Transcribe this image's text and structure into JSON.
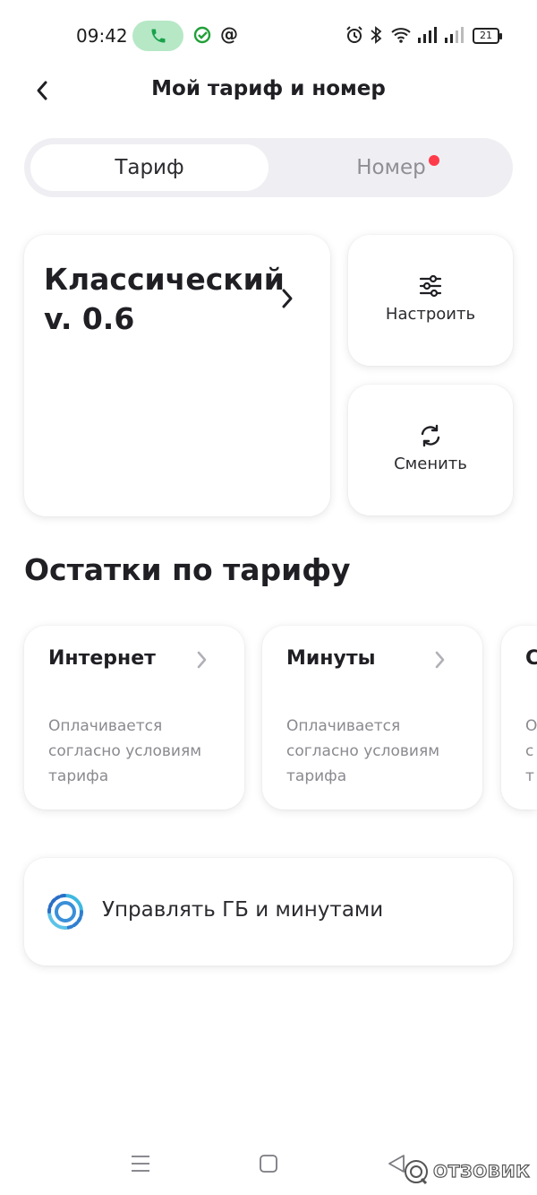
{
  "status_bar": {
    "time": "09:42",
    "battery": "21"
  },
  "header": {
    "title": "Мой тариф и номер"
  },
  "tabs": [
    {
      "label": "Тариф",
      "active": true
    },
    {
      "label": "Номер",
      "active": false,
      "has_badge": true
    }
  ],
  "tariff": {
    "name": "Классический v. 0.6"
  },
  "actions": [
    {
      "label": "Настроить",
      "icon": "sliders-icon"
    },
    {
      "label": "Сменить",
      "icon": "refresh-icon"
    }
  ],
  "remainders": {
    "title": "Остатки по тарифу",
    "items": [
      {
        "title": "Интернет",
        "description": "Оплачивается согласно условиям тарифа"
      },
      {
        "title": "Минуты",
        "description": "Оплачивается согласно условиям тарифа"
      },
      {
        "title": "С",
        "description": "О с т"
      }
    ]
  },
  "manage": {
    "label": "Управлять ГБ и минутами",
    "icon": "ring-icon"
  },
  "watermark": {
    "text": "ОТЗОВИК"
  },
  "colors": {
    "accent_red": "#ff3b4a",
    "call_green": "#b6e8c6",
    "tab_bg": "#efeff3",
    "manage_blue": "#3a8fd8"
  }
}
